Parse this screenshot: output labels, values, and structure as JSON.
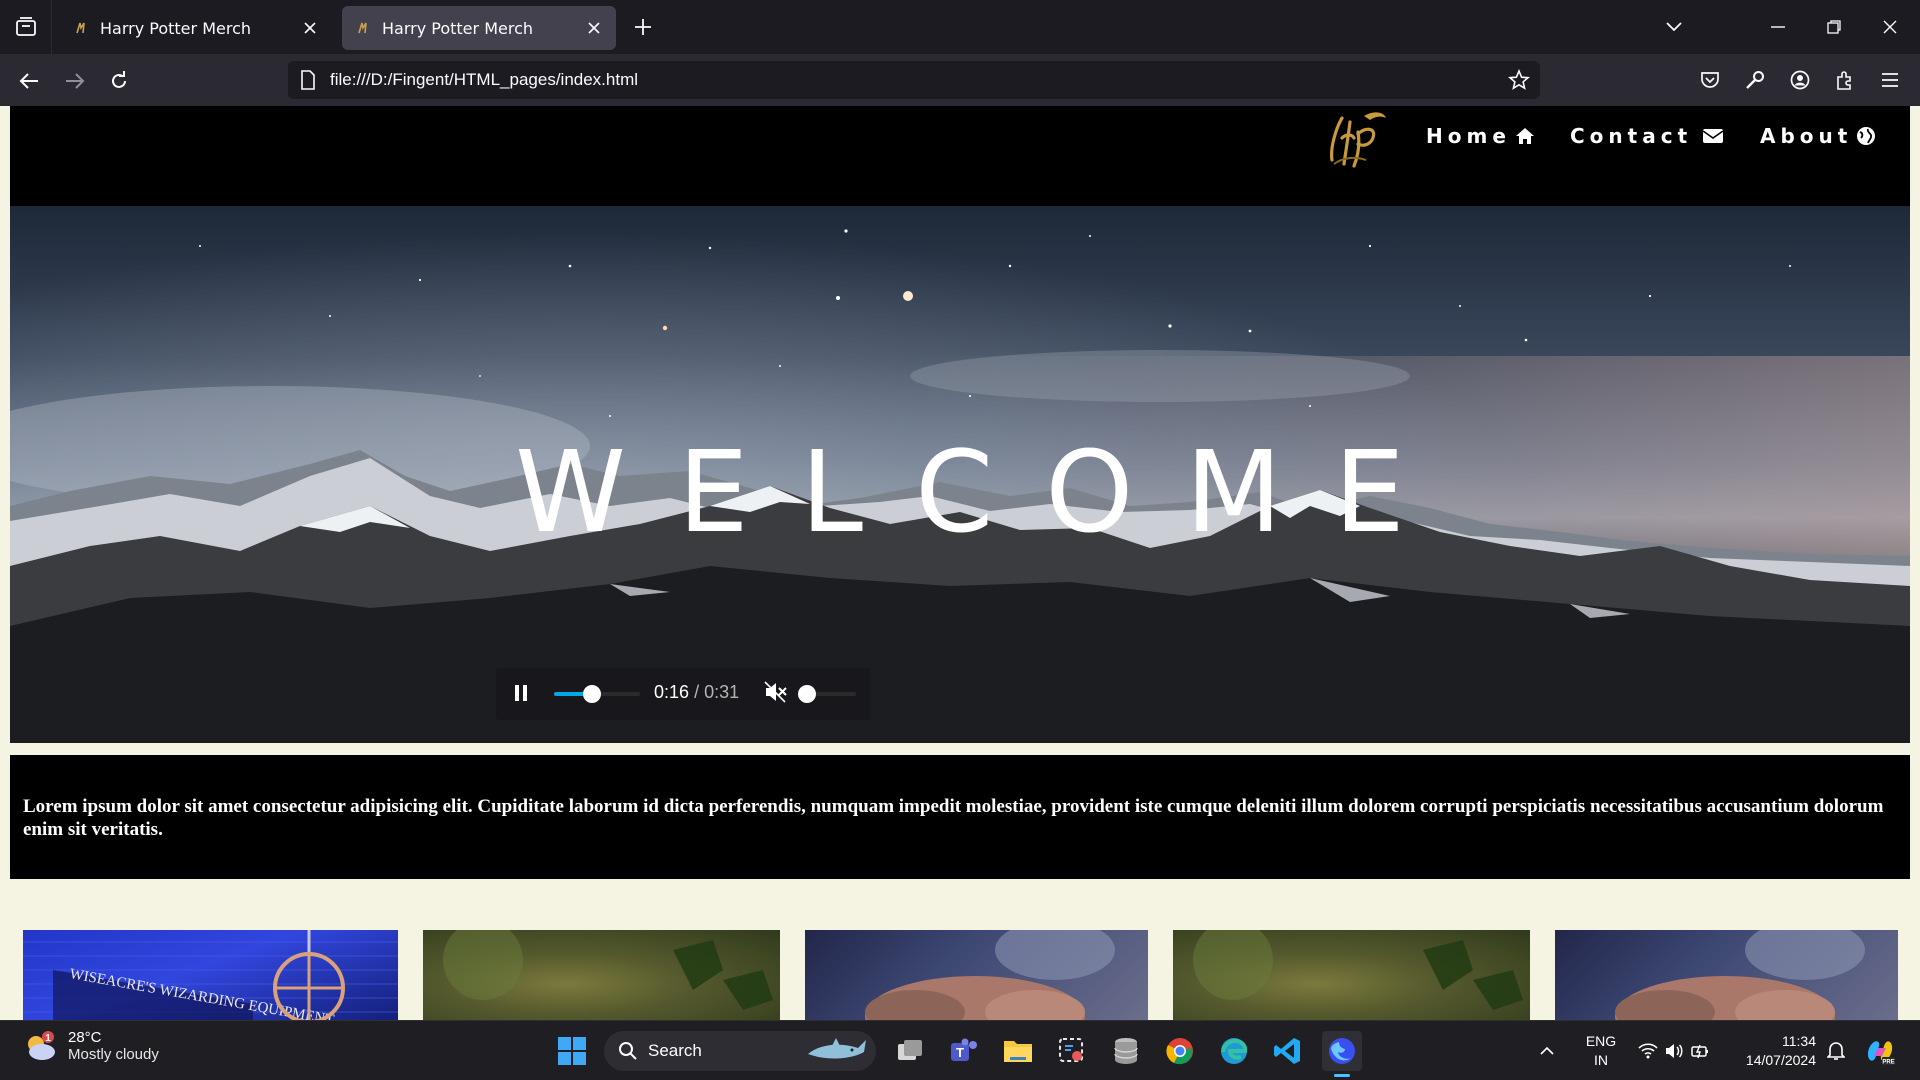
{
  "browser": {
    "tabs": [
      {
        "title": "Harry Potter Merch",
        "active": false
      },
      {
        "title": "Harry Potter Merch",
        "active": true
      }
    ],
    "url": "file:///D:/Fingent/HTML_pages/index.html"
  },
  "site": {
    "nav": [
      {
        "label": "Home",
        "icon": "home-icon"
      },
      {
        "label": "Contact",
        "icon": "envelope-icon"
      },
      {
        "label": "About",
        "icon": "globe-icon"
      }
    ],
    "hero_title": "WELCOME",
    "video": {
      "current": "0:16",
      "total": "/ 0:31",
      "progress": 0.516,
      "muted": true,
      "volume": 0
    },
    "intro_text": "Lorem ipsum dolor sit amet consectetur adipisicing elit. Cupiditate laborum id dicta perferendis, numquam impedit molestiae, provident iste cumque deleniti illum dolorem corrupti perspiciatis necessitatibus accusantium dolorum enim sit veritatis.",
    "tiles": [
      {
        "caption": "WISEACRE'S WIZARDING EQUIPMENT"
      },
      {
        "caption": ""
      },
      {
        "caption": ""
      },
      {
        "caption": ""
      },
      {
        "caption": ""
      }
    ]
  },
  "taskbar": {
    "weather_temp": "28°C",
    "weather_desc": "Mostly cloudy",
    "weather_badge": "1",
    "search_label": "Search",
    "lang_top": "ENG",
    "lang_bottom": "IN",
    "time": "11:34",
    "date": "14/07/2024"
  },
  "colors": {
    "accent": "#00a8e8",
    "tab_active": "#42414d",
    "page_bg": "#f5f4e2"
  }
}
